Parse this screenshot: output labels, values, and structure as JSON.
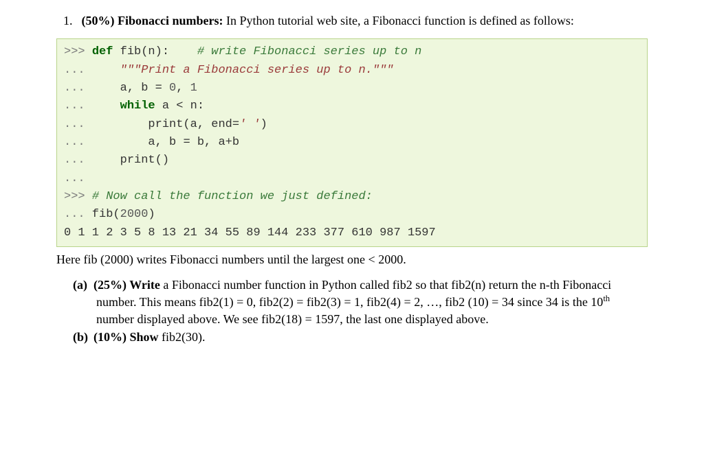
{
  "question": {
    "number": "1.",
    "weight": "(50%)",
    "title": "Fibonacci numbers:",
    "intro_rest": " In Python tutorial web site, a Fibonacci function is defined as follows:"
  },
  "code": {
    "l1_prompt": ">>> ",
    "l1_def": "def",
    "l1_rest": " fib(n):    ",
    "l1_cmt": "# write Fibonacci series up to n",
    "l2_prompt": "...",
    "l2_str": "     \"\"\"Print a Fibonacci series up to n.\"\"\"",
    "l3_prompt": "...",
    "l3_txt": "     a, b ",
    "l3_op": "=",
    "l3_txt2": " ",
    "l3_n0": "0",
    "l3_c": ", ",
    "l3_n1": "1",
    "l4_prompt": "...",
    "l4_while": "     while",
    "l4_cond": " a ",
    "l4_lt": "<",
    "l4_cond2": " n:",
    "l5_prompt": "...",
    "l5_txt": "         print(a, end",
    "l5_op": "=",
    "l5_str": "' '",
    "l5_txt2": ")",
    "l6_prompt": "...",
    "l6_txt": "         a, b ",
    "l6_op": "=",
    "l6_txt2": " b, a",
    "l6_plus": "+",
    "l6_txt3": "b",
    "l7_prompt": "...",
    "l7_txt": "     print()",
    "l8_prompt": "...",
    "l9_prompt": ">>> ",
    "l9_cmt": "# Now call the function we just defined:",
    "l10_prompt": "...",
    "l10_txt": " fib(",
    "l10_arg": "2000",
    "l10_txt2": ")",
    "output": "0 1 1 2 3 5 8 13 21 34 55 89 144 233 377 610 987 1597"
  },
  "after_code": "Here fib (2000) writes Fibonacci numbers until the largest one < 2000.",
  "part_a": {
    "label": "(a)",
    "weight": "(25%)",
    "lead": "Write",
    "text1": " a Fibonacci number function in Python called fib2 so that fib2(n) return the n-th Fibonacci number. This means fib2(1) = 0, fib2(2) = fib2(3) = 1, fib2(4) = 2, …, fib2 (10) = 34 since 34 is the 10",
    "sup": "th",
    "text2": " number displayed above. We see fib2(18) = 1597, the last one displayed above."
  },
  "part_b": {
    "label": "(b)",
    "weight": "(10%)",
    "lead": "Show",
    "text": " fib2(30)."
  }
}
